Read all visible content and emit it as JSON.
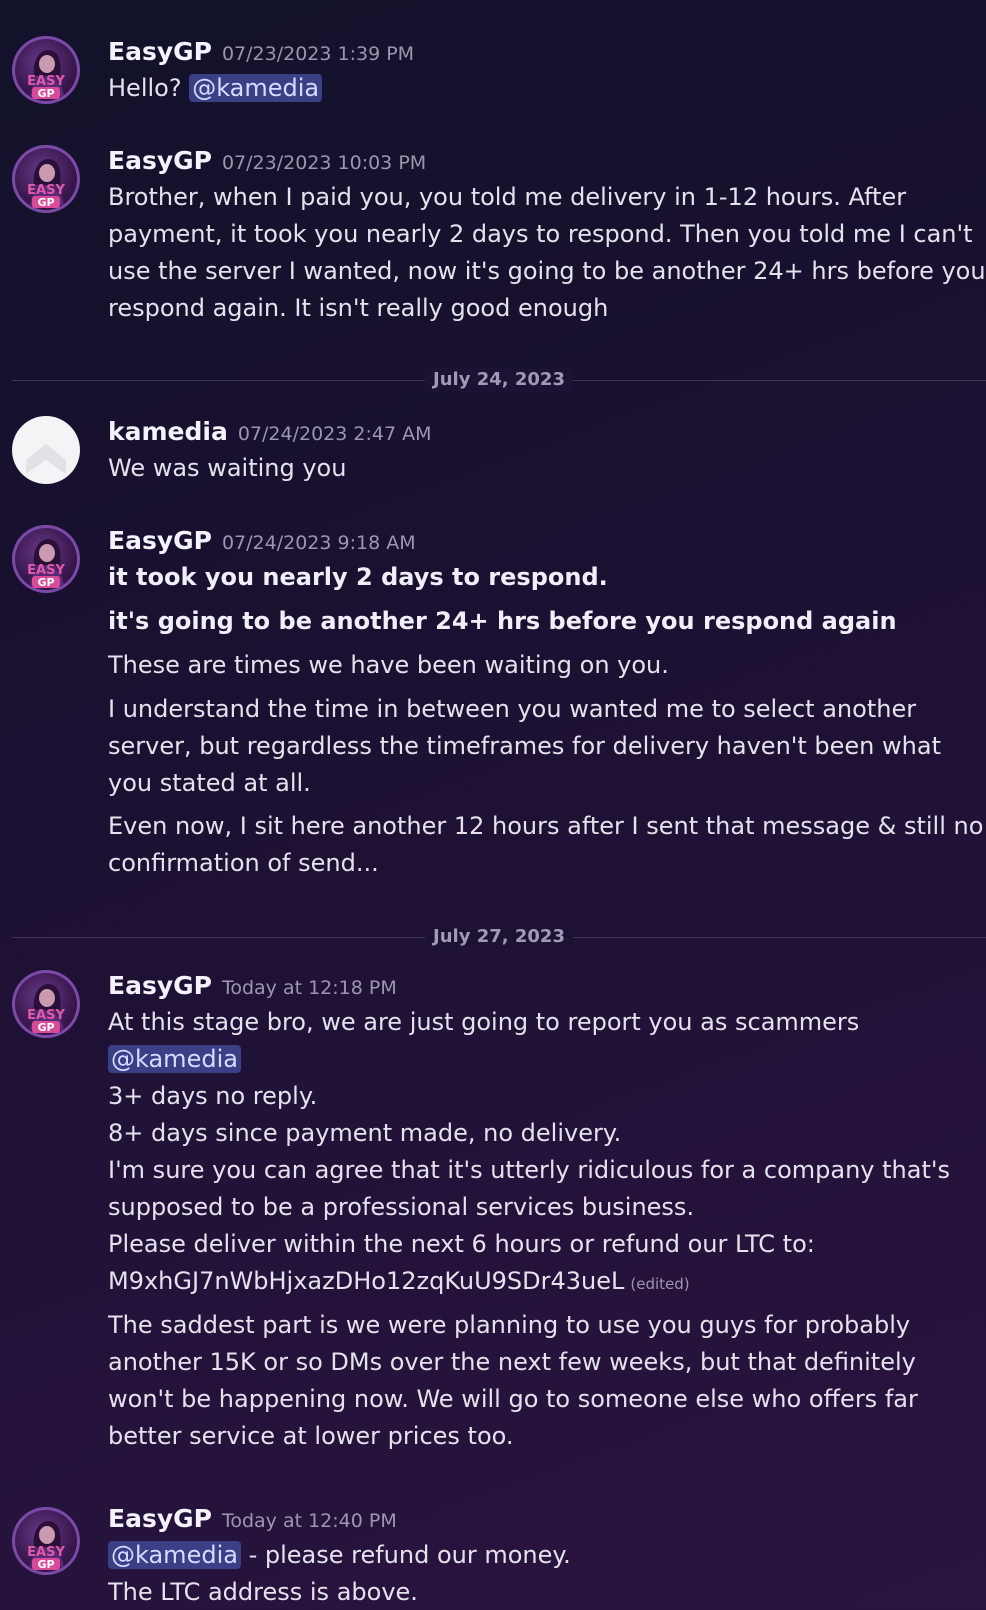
{
  "messages": [
    {
      "author": "EasyGP",
      "timestamp": "07/23/2023 1:39 PM",
      "avatar": "easygp-avatar",
      "lines": [
        {
          "pre": "Hello? ",
          "mention": "@kamedia"
        }
      ]
    },
    {
      "author": "EasyGP",
      "timestamp": "07/23/2023 10:03 PM",
      "avatar": "easygp-avatar",
      "lines": [
        {
          "text": "Brother, when I paid you, you told me delivery in 1-12 hours. After"
        },
        {
          "text": "payment, it took you nearly 2 days to respond. Then you told me I can't"
        },
        {
          "text": "use the server I wanted, now it's going to be another 24+ hrs before you"
        },
        {
          "text": "respond again. It isn't really good enough"
        }
      ]
    },
    {
      "author": "kamedia",
      "timestamp": "07/24/2023 2:47 AM",
      "avatar": "kamedia-avatar",
      "lines": [
        {
          "text": "We was waiting you"
        }
      ]
    },
    {
      "author": "EasyGP",
      "timestamp": "07/24/2023 9:18 AM",
      "avatar": "easygp-avatar",
      "lines": [
        {
          "text": "it took you nearly 2 days to respond.",
          "bold": true
        },
        {
          "text": "it's going to be another 24+ hrs before you respond again",
          "bold": true
        },
        {
          "text": "These are times we have been waiting on you."
        },
        {
          "text": "I understand the time in between you wanted me to select another"
        },
        {
          "text": "server, but regardless the timeframes for delivery haven't been what"
        },
        {
          "text": "you stated at all."
        },
        {
          "text": "Even now, I sit here another 12 hours after I sent that message & still no"
        },
        {
          "text": "confirmation of send..."
        }
      ]
    },
    {
      "author": "EasyGP",
      "timestamp": "Today at 12:18 PM",
      "avatar": "easygp-avatar",
      "lines": [
        {
          "text": "At this stage bro, we are just going to report you as scammers"
        },
        {
          "mention": "@kamedia"
        },
        {
          "text": "3+ days no reply."
        },
        {
          "text": "8+ days since payment made, no delivery."
        },
        {
          "text": "I'm sure you can agree that it's utterly ridiculous for a company that's"
        },
        {
          "text": "supposed to be a professional services business."
        },
        {
          "text": "Please deliver within the next 6 hours or refund our LTC to:"
        },
        {
          "text": "M9xhGJ7nWbHjxazDHo12zqKuU9SDr43ueL",
          "edited": "(edited)"
        },
        {
          "text": "The saddest part is we were planning to use you guys for probably"
        },
        {
          "text": "another 15K or so DMs over the next few weeks, but that definitely"
        },
        {
          "text": "won't be happening now. We will go to someone else who offers far"
        },
        {
          "text": "better service at lower prices too."
        }
      ]
    },
    {
      "author": "EasyGP",
      "timestamp": "Today at 12:40 PM",
      "avatar": "easygp-avatar",
      "lines": [
        {
          "mention": "@kamedia",
          "post": " - please refund our money."
        },
        {
          "text": "The LTC address is above."
        }
      ]
    }
  ],
  "dividers": [
    {
      "label": "July 24, 2023"
    },
    {
      "label": "July 27, 2023"
    }
  ],
  "colors": {
    "mention_bg": "#3b3f86",
    "mention_text": "#d7dcff",
    "timestamp": "#9b97ad",
    "username": "#f4f2fa"
  }
}
